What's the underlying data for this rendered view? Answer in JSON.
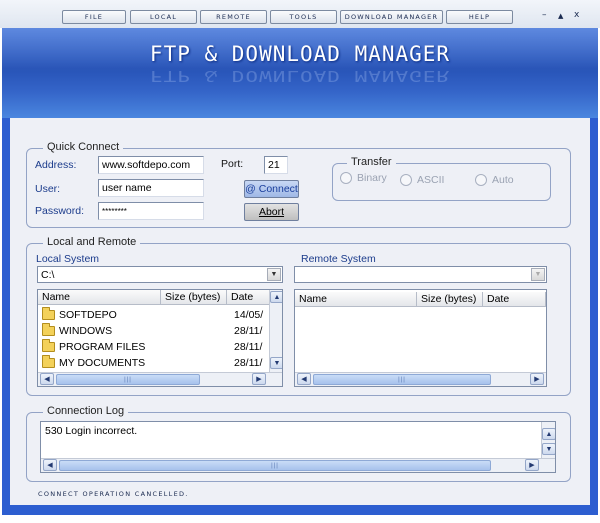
{
  "menu": [
    {
      "label": "FILE"
    },
    {
      "label": "LOCAL"
    },
    {
      "label": "REMOTE"
    },
    {
      "label": "TOOLS"
    },
    {
      "label": "DOWNLOAD MANAGER"
    },
    {
      "label": "HELP"
    }
  ],
  "window_controls": {
    "minimize": "–",
    "maximize": "▲",
    "close": "x"
  },
  "header": {
    "title": "FTP & DOWNLOAD MANAGER"
  },
  "quick_connect": {
    "title": "Quick Connect",
    "address_label": "Address:",
    "address_value": "www.softdepo.com",
    "port_label": "Port:",
    "port_value": "21",
    "user_label": "User:",
    "user_value": "user name",
    "password_label": "Password:",
    "password_value": "********",
    "connect_label": "@ Connect",
    "abort_label": "Abort"
  },
  "transfer": {
    "title": "Transfer",
    "options": [
      "Binary",
      "ASCII",
      "Auto"
    ]
  },
  "local_remote": {
    "title": "Local and Remote",
    "local": {
      "title": "Local System",
      "path": "C:\\",
      "columns": [
        "Name",
        "Size (bytes)",
        "Date"
      ],
      "rows": [
        {
          "name": "SOFTDEPO",
          "size": "",
          "date": "14/05/"
        },
        {
          "name": "WINDOWS",
          "size": "",
          "date": "28/11/"
        },
        {
          "name": "PROGRAM FILES",
          "size": "",
          "date": "28/11/"
        },
        {
          "name": "MY DOCUMENTS",
          "size": "",
          "date": "28/11/"
        }
      ]
    },
    "remote": {
      "title": "Remote System",
      "path": "",
      "columns": [
        "Name",
        "Size (bytes)",
        "Date"
      ],
      "rows": []
    }
  },
  "connection_log": {
    "title": "Connection Log",
    "text": "530 Login incorrect."
  },
  "status": {
    "text": "CONNECT OPERATION CANCELLED."
  },
  "colors": {
    "accent": "#2d5ed0",
    "banner": "#2753b7",
    "panel": "#eef0f6"
  }
}
